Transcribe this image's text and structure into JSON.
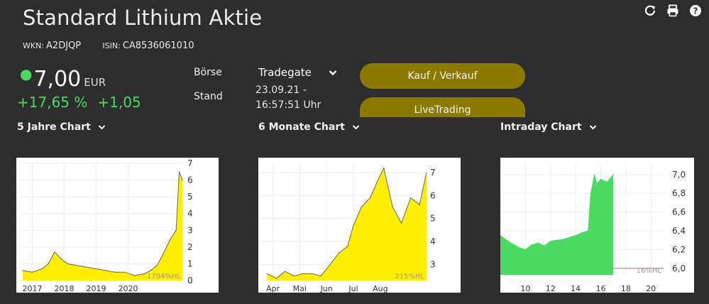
{
  "header": {
    "title": "Standard Lithium Aktie",
    "wkn_label": "WKN:",
    "wkn": "A2DJQP",
    "isin_label": "ISIN:",
    "isin": "CA8536061010"
  },
  "quote": {
    "price": "7,00",
    "currency": "EUR",
    "change_pct": "+17,65 %",
    "change_abs": "+1,05",
    "exchange_label": "Börse",
    "exchange": "Tradegate",
    "stand_label": "Stand",
    "date": "23.09.21 -",
    "time": "16:57:51 Uhr"
  },
  "buttons": {
    "trade": "Kauf / Verkauf",
    "livetrading": "LiveTrading"
  },
  "icons": [
    "refresh-icon",
    "print-icon",
    "help-icon",
    "chevron-down-icon"
  ],
  "colors": {
    "background": "#2d2d2d",
    "accent_up": "#4cd964",
    "button": "#8c7a00",
    "chart_yellow": "#ffee00",
    "chart_green": "#4cd964"
  },
  "chart_data": [
    {
      "type": "area",
      "title": "5 Jahre Chart",
      "x_ticks": [
        "2017",
        "2018",
        "2019",
        "2020"
      ],
      "y_ticks": [
        "0",
        "1",
        "2",
        "3",
        "4",
        "5",
        "6",
        "7"
      ],
      "ylim": [
        0,
        7
      ],
      "watermark": "1794%HL",
      "x": [
        "2016.7",
        "2017.0",
        "2017.3",
        "2017.5",
        "2017.7",
        "2017.9",
        "2018.1",
        "2018.4",
        "2018.7",
        "2019.0",
        "2019.3",
        "2019.6",
        "2019.9",
        "2020.2",
        "2020.5",
        "2020.7",
        "2020.9",
        "2021.1",
        "2021.3",
        "2021.5",
        "2021.6",
        "2021.7"
      ],
      "values": [
        0.6,
        0.5,
        0.7,
        1.0,
        1.7,
        1.3,
        1.0,
        0.9,
        0.8,
        0.7,
        0.6,
        0.5,
        0.5,
        0.3,
        0.4,
        0.6,
        0.9,
        1.6,
        2.4,
        3.0,
        6.5,
        6.0
      ]
    },
    {
      "type": "area",
      "title": "6 Monate Chart",
      "x_ticks": [
        "Apr",
        "Mai",
        "Jun",
        "Jul",
        "Aug"
      ],
      "y_ticks": [
        "3",
        "4",
        "5",
        "6",
        "7"
      ],
      "ylim": [
        2.3,
        7.4
      ],
      "watermark": "215%HL",
      "x": [
        "03-25",
        "04-05",
        "04-15",
        "04-25",
        "05-05",
        "05-15",
        "05-25",
        "06-05",
        "06-15",
        "06-25",
        "07-01",
        "07-10",
        "07-20",
        "07-28",
        "08-05",
        "08-15",
        "08-25",
        "09-05",
        "09-15",
        "09-23"
      ],
      "values": [
        2.6,
        2.4,
        2.7,
        2.5,
        2.6,
        2.6,
        2.5,
        3.0,
        3.5,
        3.8,
        4.7,
        5.5,
        5.9,
        6.6,
        7.2,
        5.5,
        4.8,
        5.9,
        5.6,
        7.0
      ]
    },
    {
      "type": "area",
      "title": "Intraday Chart",
      "x_ticks": [
        "10",
        "12",
        "14",
        "16",
        "18",
        "20"
      ],
      "y_ticks": [
        "6,0",
        "6,2",
        "6,4",
        "6,6",
        "6,8",
        "7,0"
      ],
      "ylim": [
        5.93,
        7.12
      ],
      "watermark": "16%HL",
      "x": [
        8.0,
        8.5,
        9.0,
        9.5,
        10.0,
        10.5,
        11.0,
        11.5,
        12.0,
        12.5,
        13.0,
        13.5,
        14.0,
        14.5,
        15.0,
        15.2,
        15.5,
        15.7,
        16.0,
        16.5,
        17.0
      ],
      "values": [
        6.35,
        6.3,
        6.26,
        6.22,
        6.2,
        6.25,
        6.27,
        6.24,
        6.29,
        6.3,
        6.31,
        6.33,
        6.35,
        6.38,
        6.4,
        6.8,
        7.0,
        6.9,
        6.95,
        6.92,
        7.0
      ]
    }
  ]
}
